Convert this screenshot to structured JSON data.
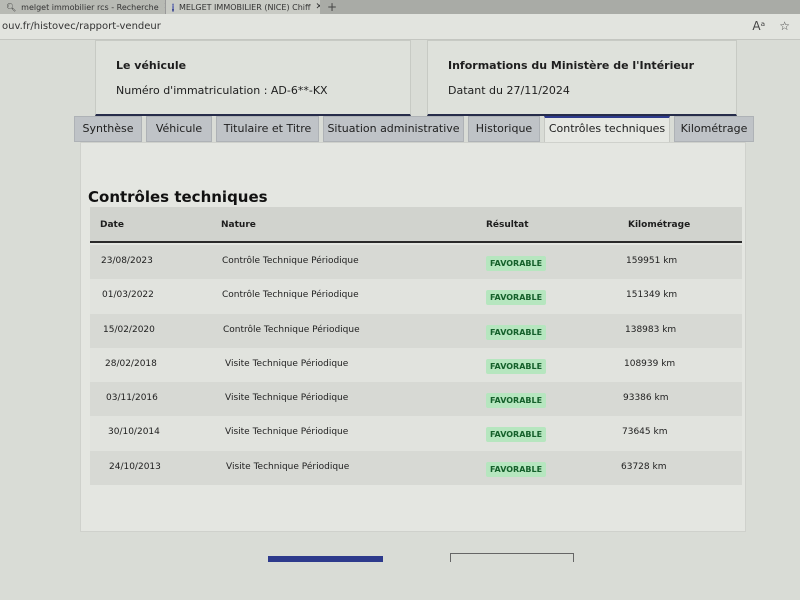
{
  "browser": {
    "tabs": [
      {
        "label": "melget immobilier rcs - Recherche"
      },
      {
        "label": "MELGET IMMOBILIER (NICE) Chiff"
      }
    ],
    "url": "ouv.fr/histovec/rapport-vendeur"
  },
  "vehicle_card": {
    "heading": "Le véhicule",
    "value": "Numéro d'immatriculation : AD-6**-KX"
  },
  "ministry_card": {
    "heading": "Informations du Ministère de l'Intérieur",
    "value": "Datant du 27/11/2024"
  },
  "tabs": [
    {
      "label": "Synthèse"
    },
    {
      "label": "Véhicule"
    },
    {
      "label": "Titulaire et Titre"
    },
    {
      "label": "Situation administrative"
    },
    {
      "label": "Historique"
    },
    {
      "label": "Contrôles techniques"
    },
    {
      "label": "Kilométrage"
    }
  ],
  "active_tab": "Contrôles techniques",
  "section_title": "Contrôles techniques",
  "table": {
    "headers": {
      "date": "Date",
      "nature": "Nature",
      "result": "Résultat",
      "mileage": "Kilométrage"
    },
    "rows": [
      {
        "date": "23/08/2023",
        "nature": "Contrôle Technique Périodique",
        "result": "FAVORABLE",
        "mileage": "159951 km"
      },
      {
        "date": "01/03/2022",
        "nature": "Contrôle Technique Périodique",
        "result": "FAVORABLE",
        "mileage": "151349 km"
      },
      {
        "date": "15/02/2020",
        "nature": "Contrôle Technique Périodique",
        "result": "FAVORABLE",
        "mileage": "138983 km"
      },
      {
        "date": "28/02/2018",
        "nature": "Visite Technique Périodique",
        "result": "FAVORABLE",
        "mileage": "108939 km"
      },
      {
        "date": "03/11/2016",
        "nature": "Visite Technique Périodique",
        "result": "FAVORABLE",
        "mileage": "93386 km"
      },
      {
        "date": "30/10/2014",
        "nature": "Visite Technique Périodique",
        "result": "FAVORABLE",
        "mileage": "73645 km"
      },
      {
        "date": "24/10/2013",
        "nature": "Visite Technique Périodique",
        "result": "FAVORABLE",
        "mileage": "63728 km"
      }
    ]
  },
  "colors": {
    "accent": "#2d3a8c",
    "success_bg": "#b6e6bf",
    "success_text": "#15602b"
  }
}
